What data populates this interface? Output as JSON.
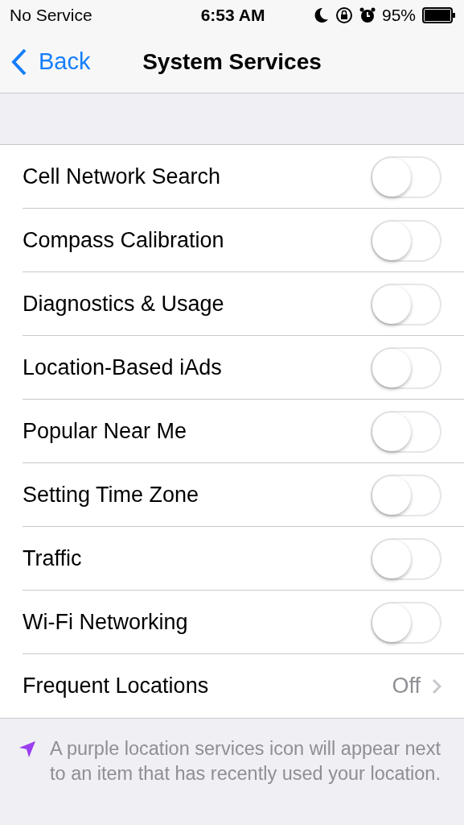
{
  "status_bar": {
    "carrier": "No Service",
    "time": "6:53 AM",
    "battery": "95%"
  },
  "nav": {
    "back": "Back",
    "title": "System Services"
  },
  "rows": [
    {
      "kind": "toggle",
      "label": "Cell Network Search",
      "on": false
    },
    {
      "kind": "toggle",
      "label": "Compass Calibration",
      "on": false
    },
    {
      "kind": "toggle",
      "label": "Diagnostics & Usage",
      "on": false
    },
    {
      "kind": "toggle",
      "label": "Location-Based iAds",
      "on": false
    },
    {
      "kind": "toggle",
      "label": "Popular Near Me",
      "on": false
    },
    {
      "kind": "toggle",
      "label": "Setting Time Zone",
      "on": false
    },
    {
      "kind": "toggle",
      "label": "Traffic",
      "on": false
    },
    {
      "kind": "toggle",
      "label": "Wi-Fi Networking",
      "on": false
    },
    {
      "kind": "disclosure",
      "label": "Frequent Locations",
      "value": "Off"
    }
  ],
  "footer": "A purple location services icon will appear next to an item that has recently used your location."
}
